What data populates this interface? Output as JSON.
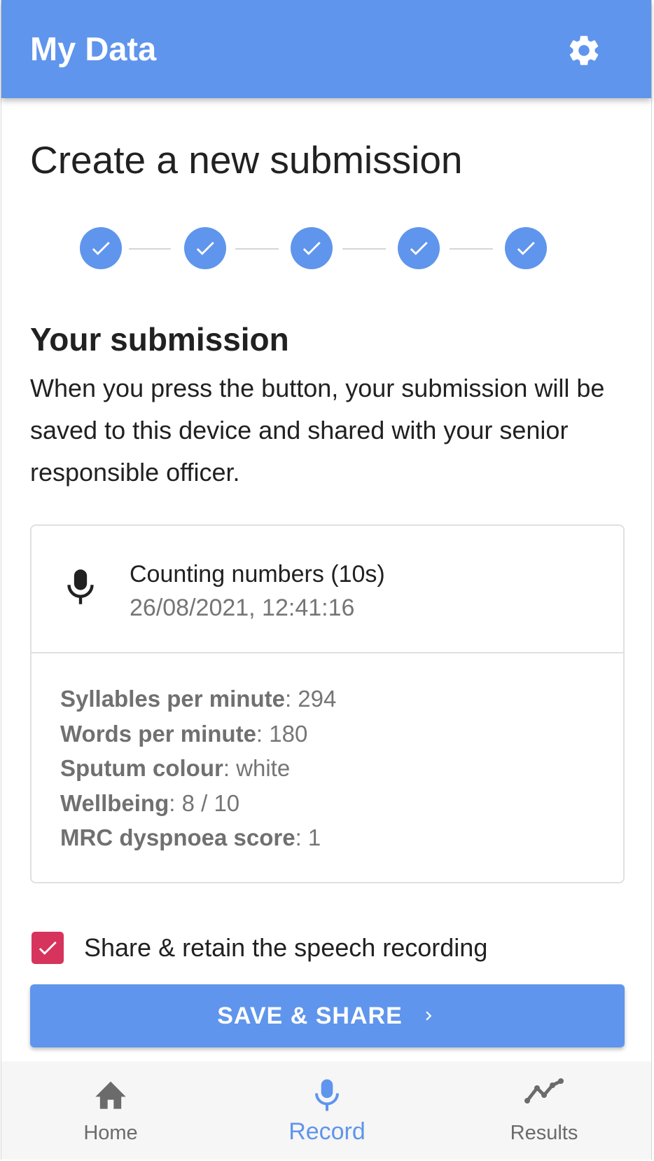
{
  "appbar": {
    "title": "My Data"
  },
  "page": {
    "title": "Create a new submission"
  },
  "stepper": {
    "completed_steps": 5,
    "total_steps": 5
  },
  "submission": {
    "heading": "Your submission",
    "body": "When you press the button, your submission will be saved to this device and shared with your senior responsible officer."
  },
  "card": {
    "title": "Counting numbers (10s)",
    "timestamp": "26/08/2021, 12:41:16",
    "metrics": [
      {
        "label": "Syllables per minute",
        "value": ": 294"
      },
      {
        "label": "Words per minute",
        "value": ": 180"
      },
      {
        "label": "Sputum colour",
        "value": ": white"
      },
      {
        "label": "Wellbeing",
        "value": ": 8 / 10"
      },
      {
        "label": "MRC dyspnoea score",
        "value": ": 1"
      }
    ]
  },
  "share_checkbox": {
    "label": "Share & retain the speech recording",
    "checked": true
  },
  "primary_button": {
    "label": "SAVE & SHARE"
  },
  "nav": {
    "items": [
      {
        "label": "Home",
        "icon": "home-icon",
        "active": false
      },
      {
        "label": "Record",
        "icon": "mic-icon",
        "active": true
      },
      {
        "label": "Results",
        "icon": "trend-icon",
        "active": false
      }
    ]
  },
  "colors": {
    "primary": "#5f95ec",
    "checkbox": "#d6345c",
    "nav_background": "#f6f6f6"
  }
}
